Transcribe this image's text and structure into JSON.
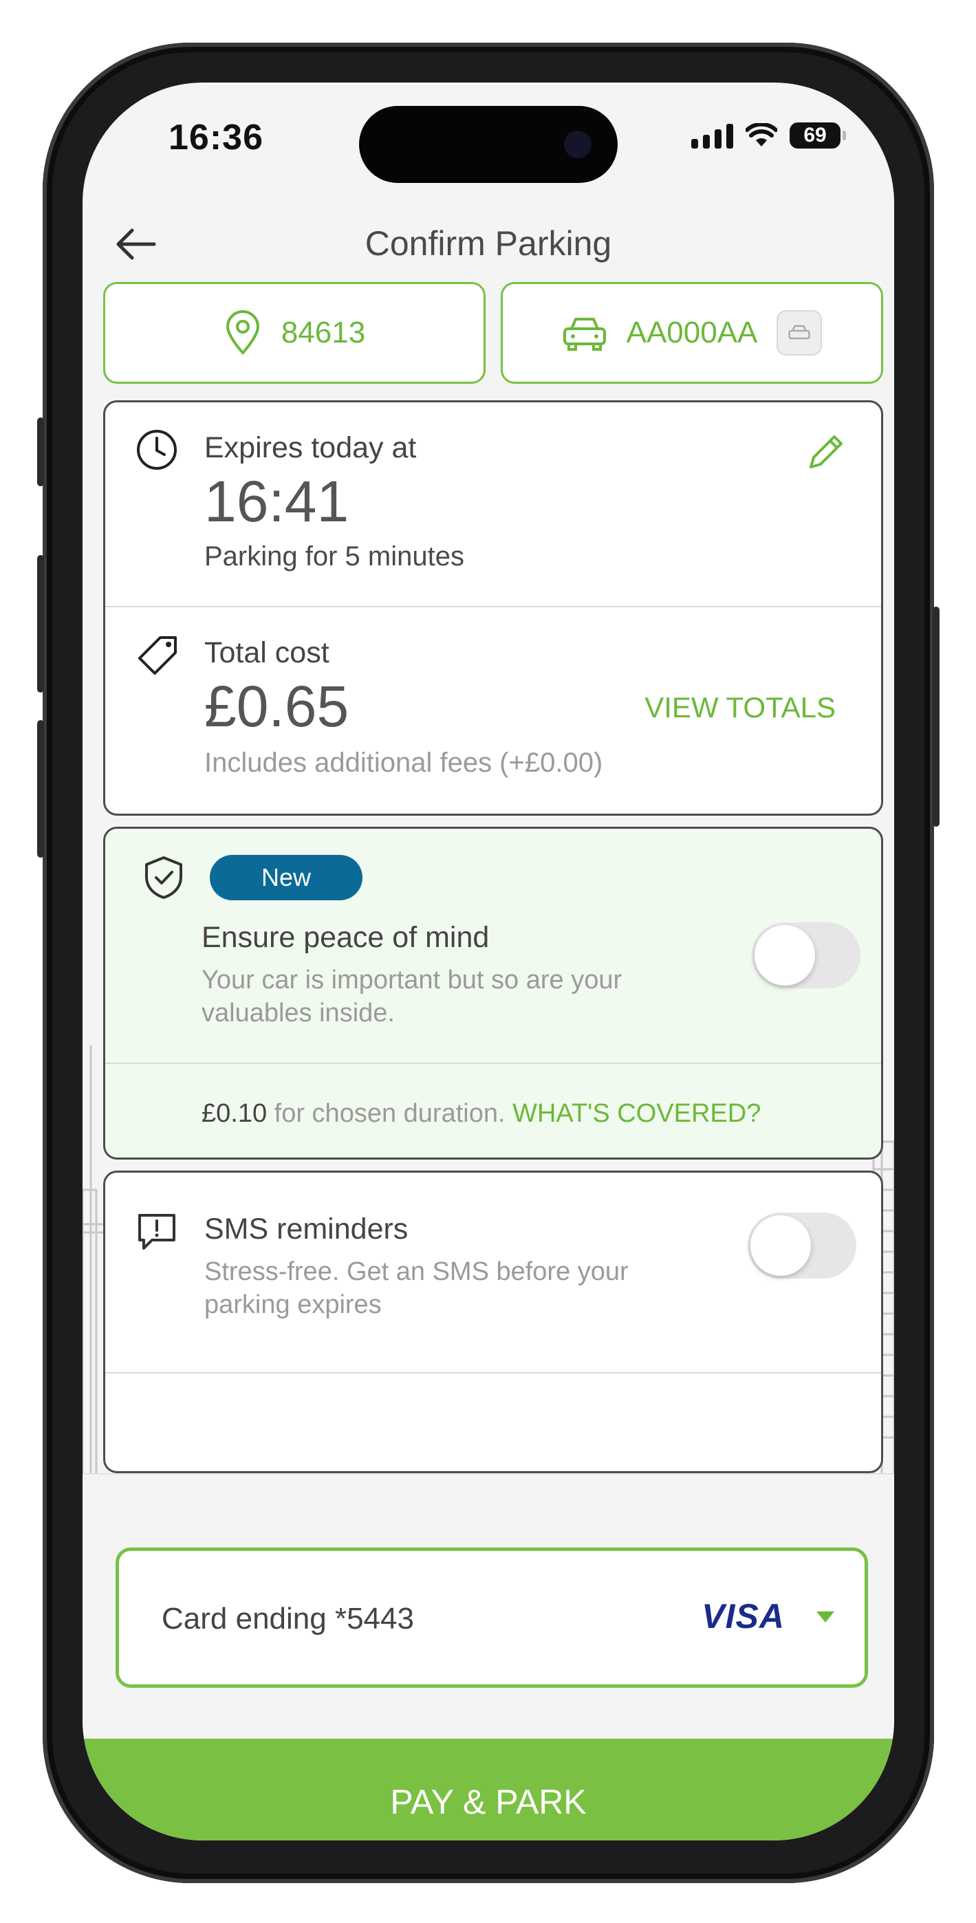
{
  "status_bar": {
    "time": "16:36",
    "battery": "69"
  },
  "header": {
    "title": "Confirm Parking",
    "back_icon": "arrow-left-icon"
  },
  "chips": {
    "location": {
      "icon": "map-pin-icon",
      "code": "84613"
    },
    "vehicle": {
      "icon": "car-icon",
      "plate": "AA000AA"
    }
  },
  "expiry": {
    "label": "Expires today at",
    "time": "16:41",
    "duration": "Parking for 5 minutes",
    "edit_icon": "pencil-icon"
  },
  "cost": {
    "label": "Total cost",
    "amount": "£0.65",
    "link": "VIEW TOTALS",
    "note": "Includes additional fees (+£0.00)"
  },
  "insurance": {
    "badge": "New",
    "title": "Ensure peace of mind",
    "desc_line1": "Your car is important but so are your",
    "desc_line2": "valuables inside.",
    "price": "£0.10",
    "price_suffix": " for chosen duration.",
    "link": "WHAT'S COVERED?",
    "toggle_on": false
  },
  "sms": {
    "title": "SMS reminders",
    "desc_line1": "Stress-free. Get an SMS before your",
    "desc_line2": "parking expires",
    "toggle_on": false
  },
  "payment": {
    "card_label": "Card ending *5443",
    "brand": "VISA"
  },
  "cta": {
    "label": "PAY & PARK"
  },
  "colors": {
    "accent": "#7ac143",
    "badge": "#0b6a98",
    "insurance_bg": "#f1faee"
  }
}
